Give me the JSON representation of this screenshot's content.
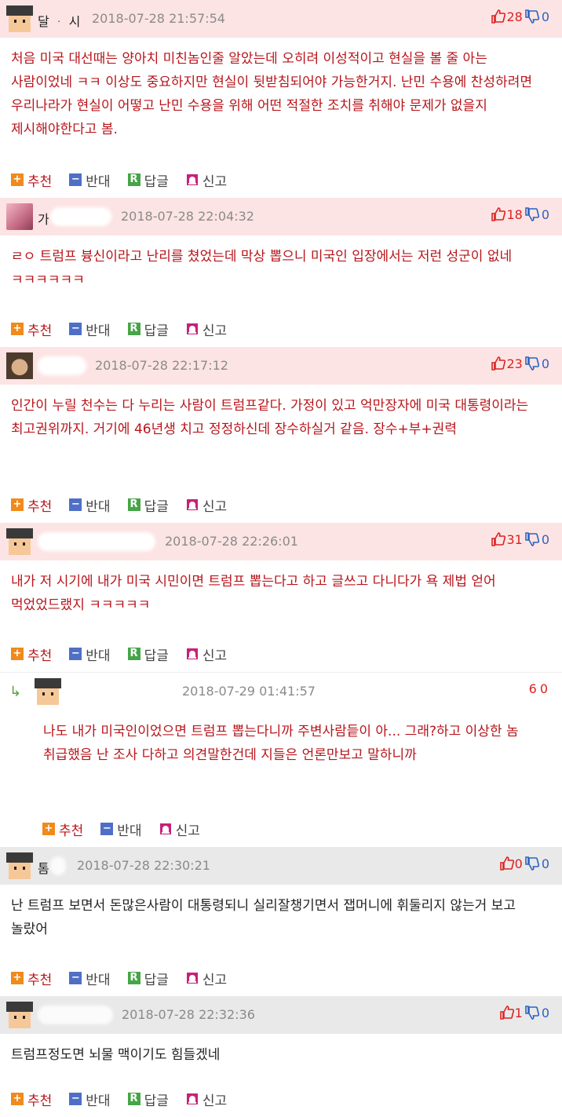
{
  "labels": {
    "recommend": "추천",
    "oppose": "반대",
    "reply": "답글",
    "report": "신고"
  },
  "colors": {
    "hot_bg": "#fde4e4",
    "plain_bg": "#e9e9e9",
    "accent_red": "#b8151b",
    "thumb_down": "#2b62c0"
  },
  "comments": [
    {
      "nick": "달 ᆞ 시",
      "date": "2018-07-28 21:57:54",
      "up": "28",
      "down": "0",
      "text": "처음 미국 대선때는 양아치 미친놈인줄 알았는데 오히려 이성적이고 현실을 볼 줄 아는 사람이었네 ㅋㅋ 이상도 중요하지만 현실이 뒷받침되어야 가능한거지. 난민 수용에 찬성하려면 우리나라가 현실이 어떻고 난민 수용을 위해 어떤 적절한 조치를 취해야 문제가 없을지 제시해야한다고 봄."
    },
    {
      "nick": "가",
      "date": "2018-07-28 22:04:32",
      "up": "18",
      "down": "0",
      "text": "ㄹㅇ 트럼프 븅신이라고 난리를 쳤었는데 막상 뽑으니 미국인 입장에서는 저런 성군이 없네 ㅋㅋㅋㅋㅋㅋ"
    },
    {
      "nick": "",
      "date": "2018-07-28 22:17:12",
      "up": "23",
      "down": "0",
      "text": "인간이 누릴 천수는 다 누리는 사람이 트럼프같다. 가정이 있고 억만장자에 미국 대통령이라는 최고권위까지. 거기에 46년생 치고 정정하신데 장수하실거 같음. 장수+부+권력"
    },
    {
      "nick": "",
      "date": "2018-07-28 22:26:01",
      "up": "31",
      "down": "0",
      "text": "내가 저 시기에 내가 미국 시민이면 트럼프 뽑는다고 하고 글쓰고 다니다가 욕 제법 얻어 먹었었드랬지 ㅋㅋㅋㅋㅋ"
    },
    {
      "nick": "",
      "date": "2018-07-29 01:41:57",
      "up": "6",
      "down": "0",
      "text": "나도 내가 미국인이었으면 트럼프 뽑는다니까 주변사람듵이 아... 그래?하고 이상한 놈 취급했음 난 조사 다하고 의견말한건데 지들은 언론만보고 말하니까"
    },
    {
      "nick": "톰",
      "date": "2018-07-28 22:30:21",
      "up": "0",
      "down": "0",
      "text": "난 트럼프 보면서 돈많은사람이 대통령되니 실리잘챙기면서 잽머니에 휘둘리지 않는거 보고 놀랐어"
    },
    {
      "nick": "",
      "date": "2018-07-28 22:32:36",
      "up": "1",
      "down": "0",
      "text": "트럼프정도면 뇌물 맥이기도 힘들겠네"
    }
  ]
}
